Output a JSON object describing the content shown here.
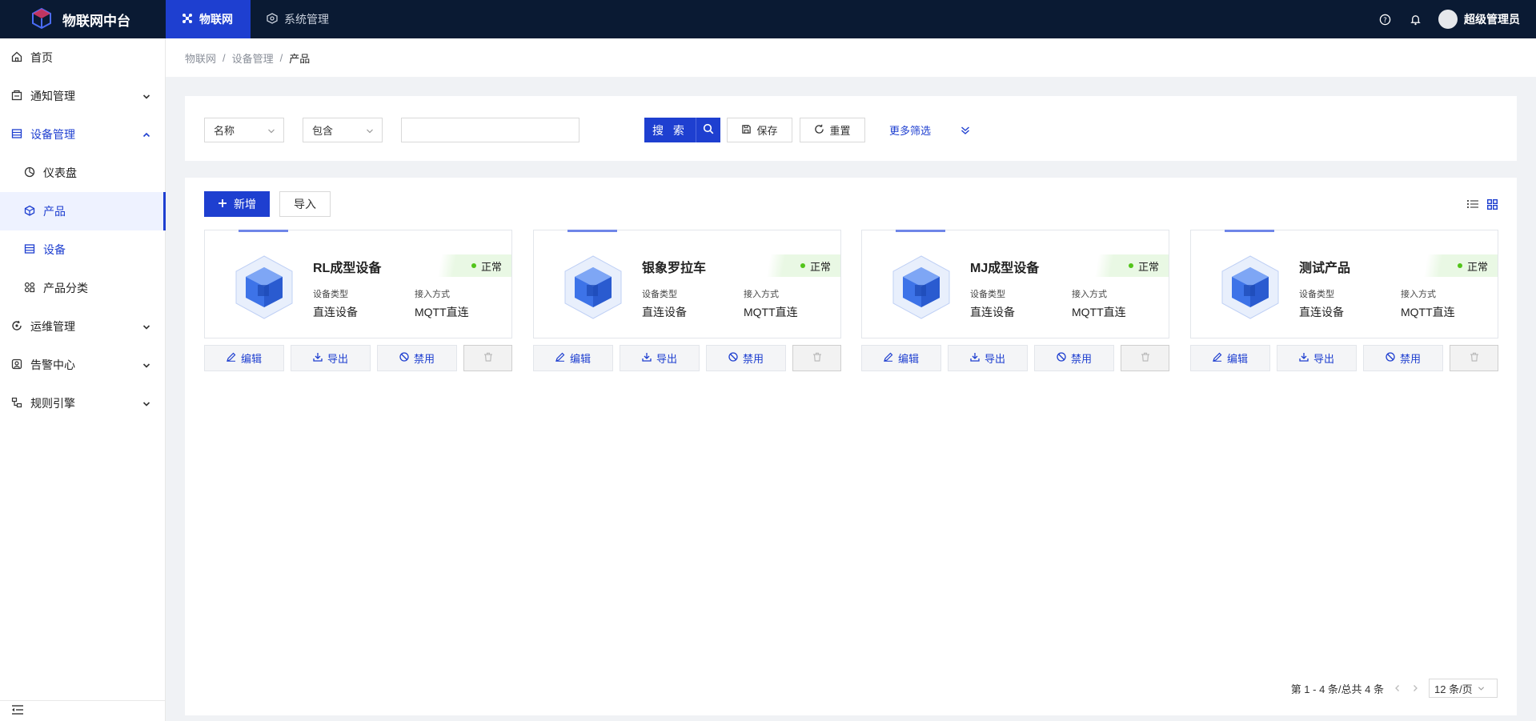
{
  "app": {
    "title": "物联网中台",
    "brand_color": "#1e3fd0"
  },
  "topnav": {
    "tabs": [
      {
        "label": "物联网",
        "icon": "cluster-icon",
        "active": true
      },
      {
        "label": "系统管理",
        "icon": "settings-cube-icon",
        "active": false
      }
    ],
    "user": "超级管理员",
    "icons": [
      "help-icon",
      "bell-icon"
    ]
  },
  "sidebar": {
    "items": [
      {
        "label": "首页",
        "icon": "home-icon"
      },
      {
        "label": "通知管理",
        "icon": "notice-icon",
        "expandable": true
      },
      {
        "label": "设备管理",
        "icon": "device-list-icon",
        "expandable": true,
        "open": true
      },
      {
        "label": "仪表盘",
        "icon": "dashboard-icon",
        "sub": true
      },
      {
        "label": "产品",
        "icon": "product-cube-icon",
        "sub": true,
        "selected": true
      },
      {
        "label": "设备",
        "icon": "device-icon",
        "sub": true
      },
      {
        "label": "产品分类",
        "icon": "category-icon",
        "sub": true
      },
      {
        "label": "运维管理",
        "icon": "ops-icon",
        "expandable": true
      },
      {
        "label": "告警中心",
        "icon": "alarm-icon",
        "expandable": true
      },
      {
        "label": "规则引擎",
        "icon": "rule-icon",
        "expandable": true
      }
    ]
  },
  "breadcrumb": {
    "items": [
      "物联网",
      "设备管理"
    ],
    "current": "产品",
    "separator": "/"
  },
  "filter": {
    "field_select": "名称",
    "operator_select": "包含",
    "value": "",
    "search_label": "搜 索",
    "save_label": "保存",
    "reset_label": "重置",
    "more_label": "更多筛选"
  },
  "toolbar": {
    "add_label": "新增",
    "import_label": "导入"
  },
  "products": [
    {
      "name": "RL成型设备",
      "status": "正常",
      "type_label": "设备类型",
      "type": "直连设备",
      "access_label": "接入方式",
      "access": "MQTT直连"
    },
    {
      "name": "银象罗拉车",
      "status": "正常",
      "type_label": "设备类型",
      "type": "直连设备",
      "access_label": "接入方式",
      "access": "MQTT直连"
    },
    {
      "name": "MJ成型设备",
      "status": "正常",
      "type_label": "设备类型",
      "type": "直连设备",
      "access_label": "接入方式",
      "access": "MQTT直连"
    },
    {
      "name": "测试产品",
      "status": "正常",
      "type_label": "设备类型",
      "type": "直连设备",
      "access_label": "接入方式",
      "access": "MQTT直连"
    }
  ],
  "card_actions": {
    "edit": "编辑",
    "export": "导出",
    "disable": "禁用"
  },
  "pagination": {
    "summary": "第 1 - 4 条/总共 4 条",
    "page_size": "12 条/页"
  },
  "colors": {
    "status_ok": "#52c41a",
    "topbar": "#0a1a33",
    "accent": "#1e3fd0"
  }
}
